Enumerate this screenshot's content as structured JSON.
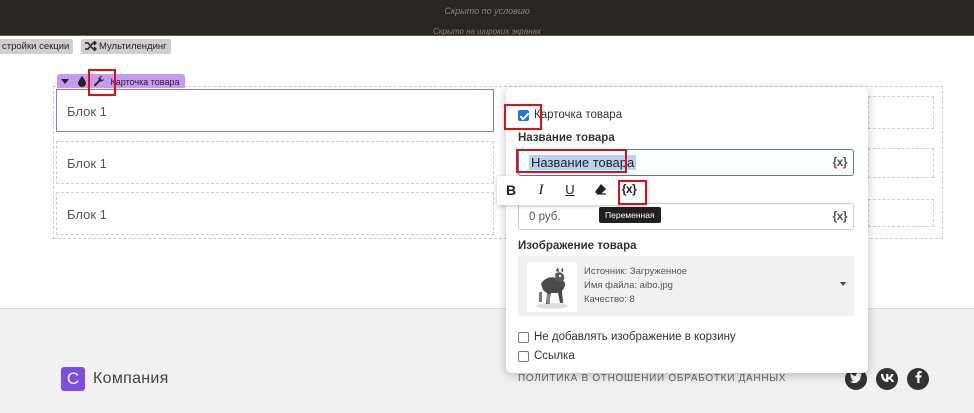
{
  "topbar": {
    "hint_conditional": "Скрыто по условию",
    "hint_wide": "Скрыто на широких экранах"
  },
  "section_bar": {
    "settings_label": "стройки секции",
    "multilanding_label": "Мультилендинг"
  },
  "card_tag": {
    "label": "Карточка товара"
  },
  "blocks": [
    {
      "label": "Блок 1"
    },
    {
      "label": "Блок 1"
    },
    {
      "label": "Блок 1"
    }
  ],
  "panel": {
    "card_checkbox": {
      "label": "Карточка товара",
      "checked": true
    },
    "name_section": {
      "heading": "Название товара",
      "value": "Название товара",
      "var_button": "{x}"
    },
    "price_field": {
      "value": "0 руб.",
      "var_button": "{x}"
    },
    "image_section": {
      "heading": "Изображение товара",
      "source": "Источник: Загруженное",
      "filename": "Имя файла: aibo.jpg",
      "quality": "Качество: 8"
    },
    "no_cart_image": {
      "label": "Не добавлять изображение в корзину",
      "checked": false
    },
    "link": {
      "label": "Ссылка",
      "checked": false
    }
  },
  "format_toolbar": {
    "bold": "B",
    "italic": "I",
    "underline": "U",
    "variable_button": "{x}",
    "tooltip": "Переменная"
  },
  "footer": {
    "logo_letter": "C",
    "company": "Компания",
    "policy": "ПОЛИТИКА В ОТНОШЕНИИ ОБРАБОТКИ ДАННЫХ",
    "social": [
      "twitter-icon",
      "vk-icon",
      "facebook-icon"
    ]
  },
  "colors": {
    "accent_purple": "#c69af3",
    "selection_border": "#a46be0",
    "highlight_red": "#e01010",
    "focus_blue": "#4a7bd0",
    "topbar": "#2a2522"
  }
}
